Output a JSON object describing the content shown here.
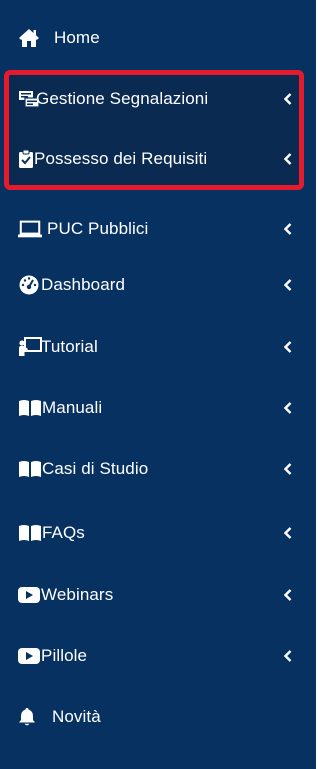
{
  "sidebar": {
    "background": "#063161",
    "highlight_color": "#e41b2d",
    "items": [
      {
        "label": "Home",
        "icon": "home-icon",
        "has_submenu": false
      },
      {
        "label": "Gestione Segnalazioni",
        "icon": "reports-icon",
        "has_submenu": true
      },
      {
        "label": "Possesso dei Requisiti",
        "icon": "clipboard-check-icon",
        "has_submenu": true
      },
      {
        "label": "PUC Pubblici",
        "icon": "laptop-icon",
        "has_submenu": true
      },
      {
        "label": "Dashboard",
        "icon": "gauge-icon",
        "has_submenu": true
      },
      {
        "label": "Tutorial",
        "icon": "presentation-icon",
        "has_submenu": true
      },
      {
        "label": "Manuali",
        "icon": "book-icon",
        "has_submenu": true
      },
      {
        "label": "Casi di Studio",
        "icon": "book-icon",
        "has_submenu": true
      },
      {
        "label": "FAQs",
        "icon": "book-icon",
        "has_submenu": true
      },
      {
        "label": "Webinars",
        "icon": "youtube-play-icon",
        "has_submenu": true
      },
      {
        "label": "Pillole",
        "icon": "youtube-play-icon",
        "has_submenu": true
      },
      {
        "label": "Novità",
        "icon": "bell-icon",
        "has_submenu": false
      }
    ]
  }
}
